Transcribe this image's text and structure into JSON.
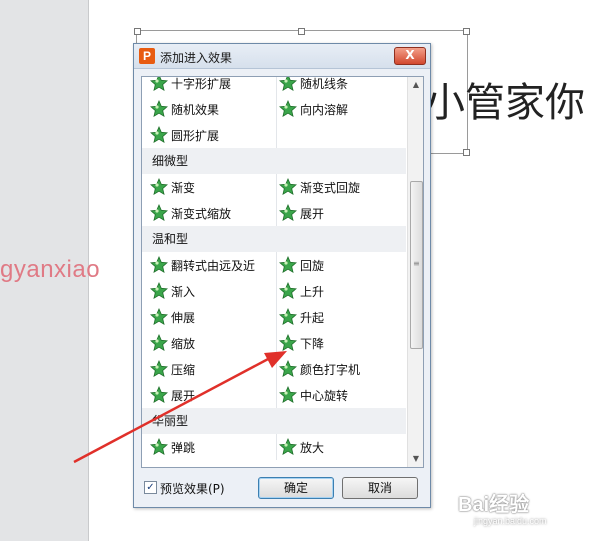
{
  "slide": {
    "title_text": "小管家你",
    "watermark_left": "gyanxiao"
  },
  "dialog": {
    "title": "添加进入效果",
    "app_icon_letter": "P",
    "close_symbol": "X",
    "groups": [
      {
        "category": "",
        "rows": [
          [
            "十字形扩展",
            "随机线条"
          ],
          [
            "随机效果",
            "向内溶解"
          ],
          [
            "圆形扩展",
            ""
          ]
        ]
      },
      {
        "category": "细微型",
        "rows": [
          [
            "渐变",
            "渐变式回旋"
          ],
          [
            "渐变式缩放",
            "展开"
          ]
        ]
      },
      {
        "category": "温和型",
        "rows": [
          [
            "翻转式由远及近",
            "回旋"
          ],
          [
            "渐入",
            "上升"
          ],
          [
            "伸展",
            "升起"
          ],
          [
            "缩放",
            "下降"
          ],
          [
            "压缩",
            "颜色打字机"
          ],
          [
            "展开",
            "中心旋转"
          ]
        ]
      },
      {
        "category": "华丽型",
        "rows": [
          [
            "弹跳",
            "放大"
          ]
        ]
      }
    ],
    "preview_checked": true,
    "preview_label": "预览效果(P)",
    "ok_label": "确定",
    "cancel_label": "取消"
  },
  "watermark": {
    "brand": "Bai经验",
    "url": "jingyan.baidu.com"
  },
  "colors": {
    "star_green": "#3aa54a",
    "arrow_red": "#e0302a",
    "accent_blue": "#3c7fb1"
  }
}
